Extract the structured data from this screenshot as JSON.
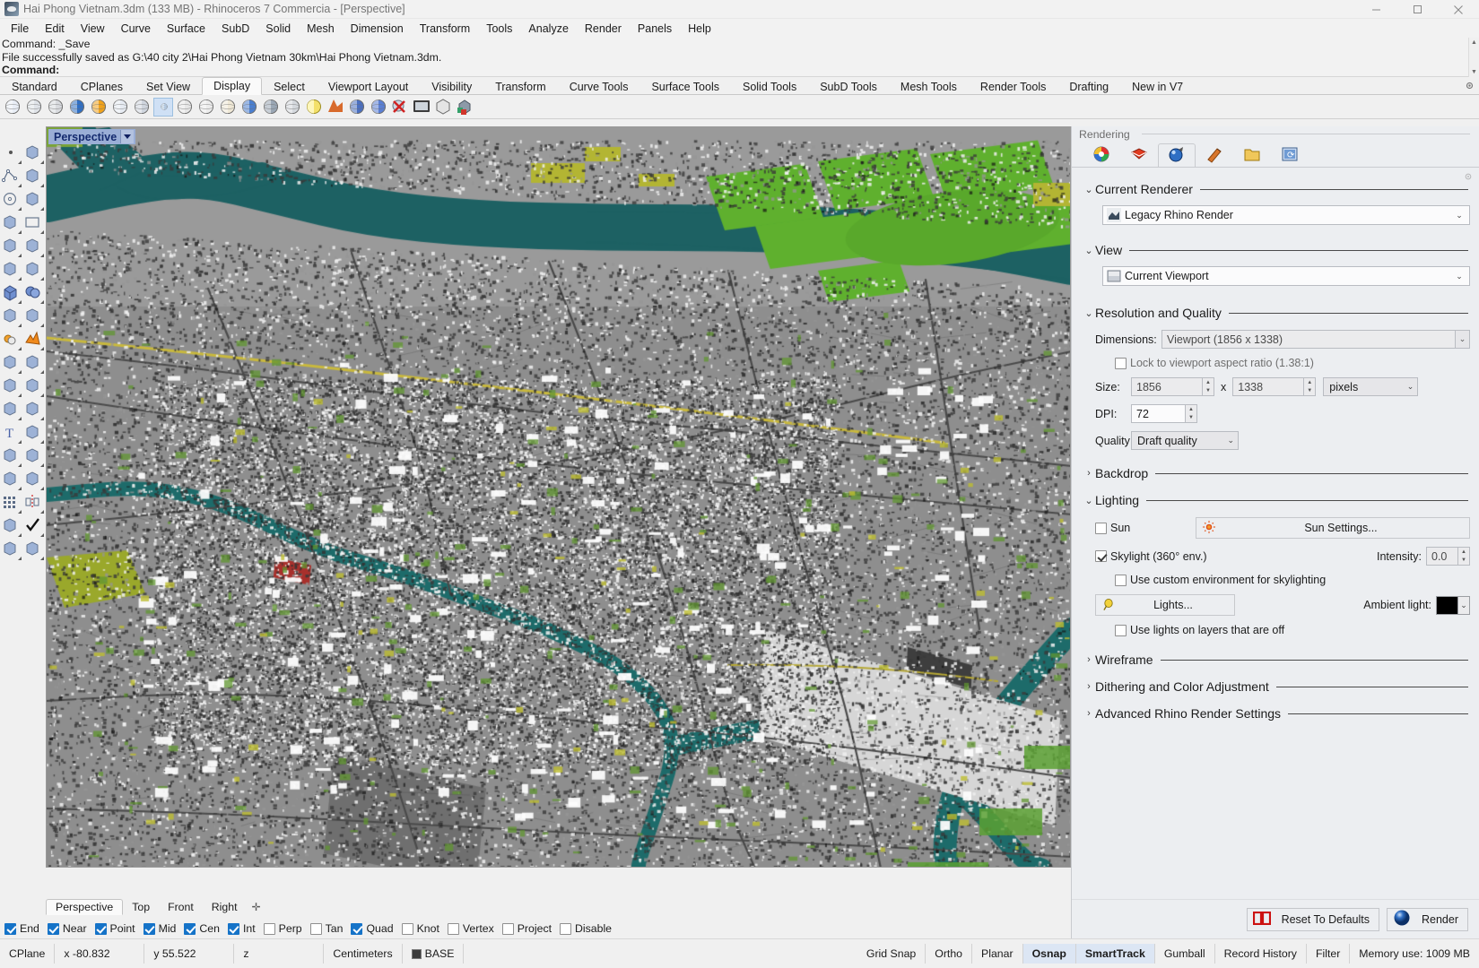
{
  "window": {
    "title": "Hai Phong Vietnam.3dm (133 MB) - Rhinoceros 7 Commercia - [Perspective]",
    "app_icon": "rhino-logo-icon",
    "minimize": "minimize-icon",
    "maximize": "maximize-icon",
    "close": "close-icon"
  },
  "menu": {
    "items": [
      "File",
      "Edit",
      "View",
      "Curve",
      "Surface",
      "SubD",
      "Solid",
      "Mesh",
      "Dimension",
      "Transform",
      "Tools",
      "Analyze",
      "Render",
      "Panels",
      "Help"
    ]
  },
  "command": {
    "line1": "Command: _Save",
    "line2": "File successfully saved as G:\\40 city 2\\Hai Phong Vietnam 30km\\Hai Phong Vietnam.3dm.",
    "line3": "Command:"
  },
  "toolbar_tabs": {
    "items": [
      "Standard",
      "CPlanes",
      "Set View",
      "Display",
      "Select",
      "Viewport Layout",
      "Visibility",
      "Transform",
      "Curve Tools",
      "Surface Tools",
      "Solid Tools",
      "SubD Tools",
      "Mesh Tools",
      "Render Tools",
      "Drafting",
      "New in V7"
    ],
    "active": "Display",
    "options_icon": "gear-icon"
  },
  "display_icons": [
    {
      "name": "wireframe-icon",
      "color": "#e9eef6"
    },
    {
      "name": "shaded-icon",
      "color": "#dfe3e8"
    },
    {
      "name": "shaded-grey-icon",
      "color": "#d8dade"
    },
    {
      "name": "rendered-icon",
      "color": "#2f6fc4"
    },
    {
      "name": "arctic-icon",
      "color": "#f0a31d"
    },
    {
      "name": "ghosted-icon",
      "color": "#e6ebf2"
    },
    {
      "name": "xray-icon",
      "color": "#cfd5de"
    },
    {
      "name": "pen-icon",
      "color": "#b9cfe8"
    },
    {
      "name": "technical-icon",
      "color": "#e6e6e6"
    },
    {
      "name": "artistic-icon",
      "color": "#ececec"
    },
    {
      "name": "raytraced-icon",
      "color": "#efe8d6"
    },
    {
      "name": "cycles-icon",
      "color": "#4a7fd0"
    },
    {
      "name": "shade-selected-icon",
      "color": "#9aa7b5"
    },
    {
      "name": "shade-half-icon",
      "color": "#d4d8dd"
    },
    {
      "name": "light-yellow-icon",
      "color": "#f3e06a"
    },
    {
      "name": "shadows-icon",
      "color": "#d86a2c"
    },
    {
      "name": "display-blue-icon",
      "color": "#4a6fc0"
    },
    {
      "name": "display-pin-icon",
      "color": "#5a7fd4"
    },
    {
      "name": "display-off-icon",
      "color": "#d02222"
    },
    {
      "name": "full-screen-icon",
      "color": "#3c3c3c"
    },
    {
      "name": "box-edit-icon",
      "color": "#dedede"
    },
    {
      "name": "colored-box-icon",
      "color": "#33a06a"
    }
  ],
  "left_tools": [
    "point-icon",
    "point-cloud-icon",
    "polyline-icon",
    "control-point-curve-icon",
    "circle-icon",
    "ellipse-icon",
    "polygon-icon",
    "rectangle-icon",
    "arc-icon",
    "curve-icon",
    "surface-corner-icon",
    "surface-loft-icon",
    "box-icon",
    "sphere-icon",
    "tube-icon",
    "surface-patch-icon",
    "boolean-union-icon",
    "explode-icon",
    "trim-icon",
    "split-icon",
    "boolean-difference-icon",
    "boolean-intersect-icon",
    "fillet-icon",
    "offset-curve-icon",
    "text-icon",
    "dimension-icon",
    "array-icon",
    "copy-icon",
    "extrude-icon",
    "mesh-icon",
    "grid-icon",
    "mirror-icon",
    "layer-icon",
    "checkmark-icon",
    "misc-icon",
    "misc2-icon"
  ],
  "viewport": {
    "label": "Perspective",
    "dropdown_icon": "chevron-down-icon",
    "tabs": [
      "Perspective",
      "Top",
      "Front",
      "Right"
    ],
    "active_tab": "Perspective",
    "add_tab_icon": "add-viewport-icon"
  },
  "osnap": {
    "items": [
      {
        "label": "End",
        "checked": true
      },
      {
        "label": "Near",
        "checked": true
      },
      {
        "label": "Point",
        "checked": true
      },
      {
        "label": "Mid",
        "checked": true
      },
      {
        "label": "Cen",
        "checked": true
      },
      {
        "label": "Int",
        "checked": true
      },
      {
        "label": "Perp",
        "checked": false
      },
      {
        "label": "Tan",
        "checked": false
      },
      {
        "label": "Quad",
        "checked": true
      },
      {
        "label": "Knot",
        "checked": false
      },
      {
        "label": "Vertex",
        "checked": false
      },
      {
        "label": "Project",
        "checked": false
      },
      {
        "label": "Disable",
        "checked": false
      }
    ]
  },
  "statusbar": {
    "cplane": "CPlane",
    "x": "x -80.832",
    "y": "y 55.522",
    "z": "z",
    "units": "Centimeters",
    "layer": "BASE",
    "toggles": [
      {
        "label": "Grid Snap",
        "active": false
      },
      {
        "label": "Ortho",
        "active": false
      },
      {
        "label": "Planar",
        "active": false
      },
      {
        "label": "Osnap",
        "active": true
      },
      {
        "label": "SmartTrack",
        "active": true
      },
      {
        "label": "Gumball",
        "active": false
      },
      {
        "label": "Record History",
        "active": false
      },
      {
        "label": "Filter",
        "active": false
      }
    ],
    "memory": "Memory use: 1009 MB"
  },
  "panel": {
    "header": "Rendering",
    "tabs": [
      {
        "name": "materials-icon",
        "active": false
      },
      {
        "name": "environments-icon",
        "active": false
      },
      {
        "name": "rendering-icon",
        "active": true
      },
      {
        "name": "ground-plane-icon",
        "active": false
      },
      {
        "name": "libraries-icon",
        "active": false
      },
      {
        "name": "render-window-icon",
        "active": false
      }
    ],
    "options_icon": "gear-icon",
    "sections": {
      "current_renderer": {
        "title": "Current Renderer",
        "expanded": true,
        "value": "Legacy Rhino Render",
        "icon": "rhino-render-icon"
      },
      "view": {
        "title": "View",
        "expanded": true,
        "value": "Current Viewport",
        "icon": "viewport-icon"
      },
      "resolution_quality": {
        "title": "Resolution and Quality",
        "expanded": true,
        "dimensions_label": "Dimensions:",
        "dimensions_value": "Viewport (1856 x 1338)",
        "lock_aspect_label": "Lock to viewport aspect ratio (1.38:1)",
        "lock_aspect_checked": false,
        "size_label": "Size:",
        "size_width": "1856",
        "size_x": "x",
        "size_height": "1338",
        "size_units": "pixels",
        "dpi_label": "DPI:",
        "dpi_value": "72",
        "quality_label": "Quality:",
        "quality_value": "Draft quality"
      },
      "backdrop": {
        "title": "Backdrop",
        "expanded": false
      },
      "lighting": {
        "title": "Lighting",
        "expanded": true,
        "sun_label": "Sun",
        "sun_checked": false,
        "sun_settings_label": "Sun Settings...",
        "sun_icon": "sun-icon",
        "skylight_label": "Skylight (360° env.)",
        "skylight_checked": true,
        "intensity_label": "Intensity:",
        "intensity_value": "0.0",
        "custom_env_label": "Use custom environment for skylighting",
        "custom_env_checked": false,
        "lights_label": "Lights...",
        "lights_icon": "lightbulb-icon",
        "ambient_label": "Ambient light:",
        "ambient_color": "#000000",
        "lights_off_label": "Use lights on layers that are off",
        "lights_off_checked": false
      },
      "wireframe": {
        "title": "Wireframe",
        "expanded": false
      },
      "dithering": {
        "title": "Dithering and Color Adjustment",
        "expanded": false
      },
      "advanced": {
        "title": "Advanced Rhino Render Settings",
        "expanded": false
      }
    },
    "footer": {
      "reset_label": "Reset To Defaults",
      "reset_icon": "counter-00-icon",
      "render_label": "Render",
      "render_icon": "render-sphere-icon"
    }
  }
}
